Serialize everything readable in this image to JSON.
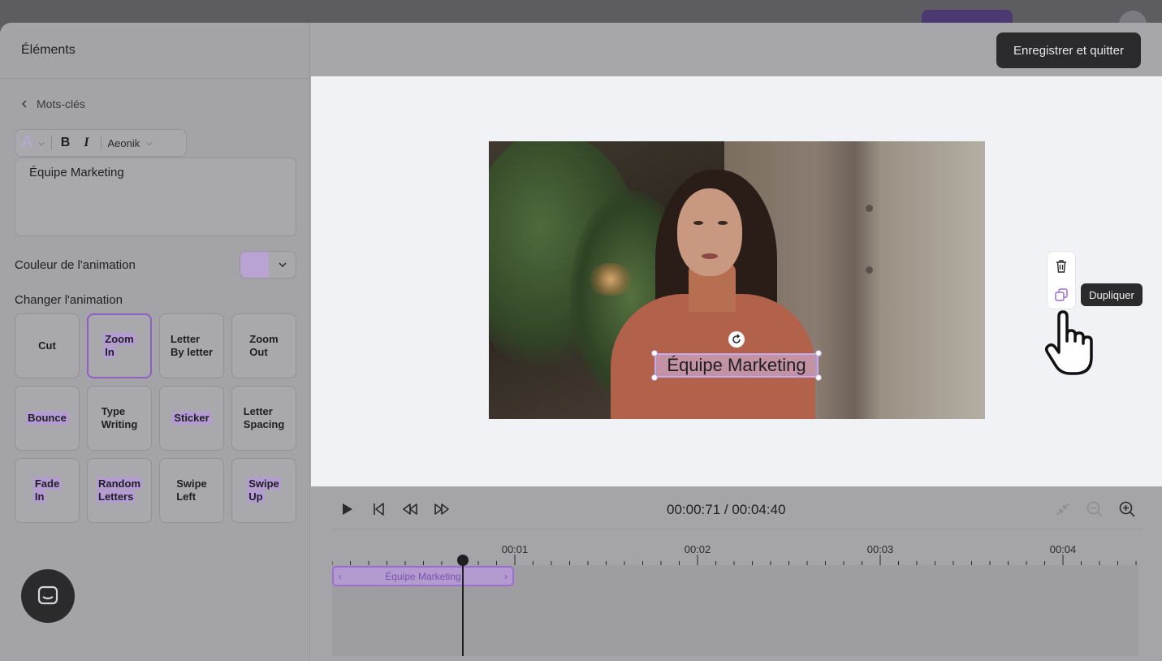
{
  "left_panel": {
    "title": "Éléments",
    "back_label": "Mots-clés",
    "toolbar": {
      "text_color_letter": "A",
      "bold": "B",
      "italic": "I",
      "font": "Aeonik"
    },
    "text_value": "Équipe Marketing",
    "animation_color_label": "Couleur de l'animation",
    "animation_color": "#b8a3d2",
    "change_animation_label": "Changer l'animation",
    "animations": [
      {
        "l1": "Cut",
        "l2": ""
      },
      {
        "l1": "Zoom",
        "l2": "In"
      },
      {
        "l1": "Letter",
        "l2": "By letter"
      },
      {
        "l1": "Zoom",
        "l2": "Out"
      },
      {
        "l1": "Bounce",
        "l2": ""
      },
      {
        "l1": "Type",
        "l2": "Writing"
      },
      {
        "l1": "Sticker",
        "l2": ""
      },
      {
        "l1": "Letter",
        "l2": "Spacing"
      },
      {
        "l1": "Fade",
        "l2": "In"
      },
      {
        "l1": "Random",
        "l2": "Letters"
      },
      {
        "l1": "Swipe",
        "l2": "Left"
      },
      {
        "l1": "Swipe",
        "l2": "Up"
      }
    ],
    "selected_animation": "Zoom In"
  },
  "header": {
    "save_label": "Enregistrer et quitter"
  },
  "canvas": {
    "caption": "Équipe Marketing",
    "tooltip": "Dupliquer",
    "tools": [
      "trash-icon",
      "duplicate-icon"
    ]
  },
  "timeline": {
    "time_display": "00:00:71 / 00:04:40",
    "ticks": [
      "00:01",
      "00:02",
      "00:03",
      "00:04"
    ],
    "clip_label": "Équipe Marketing"
  },
  "colors": {
    "accent": "#9d6fd4",
    "dark": "#2b2b2e"
  }
}
